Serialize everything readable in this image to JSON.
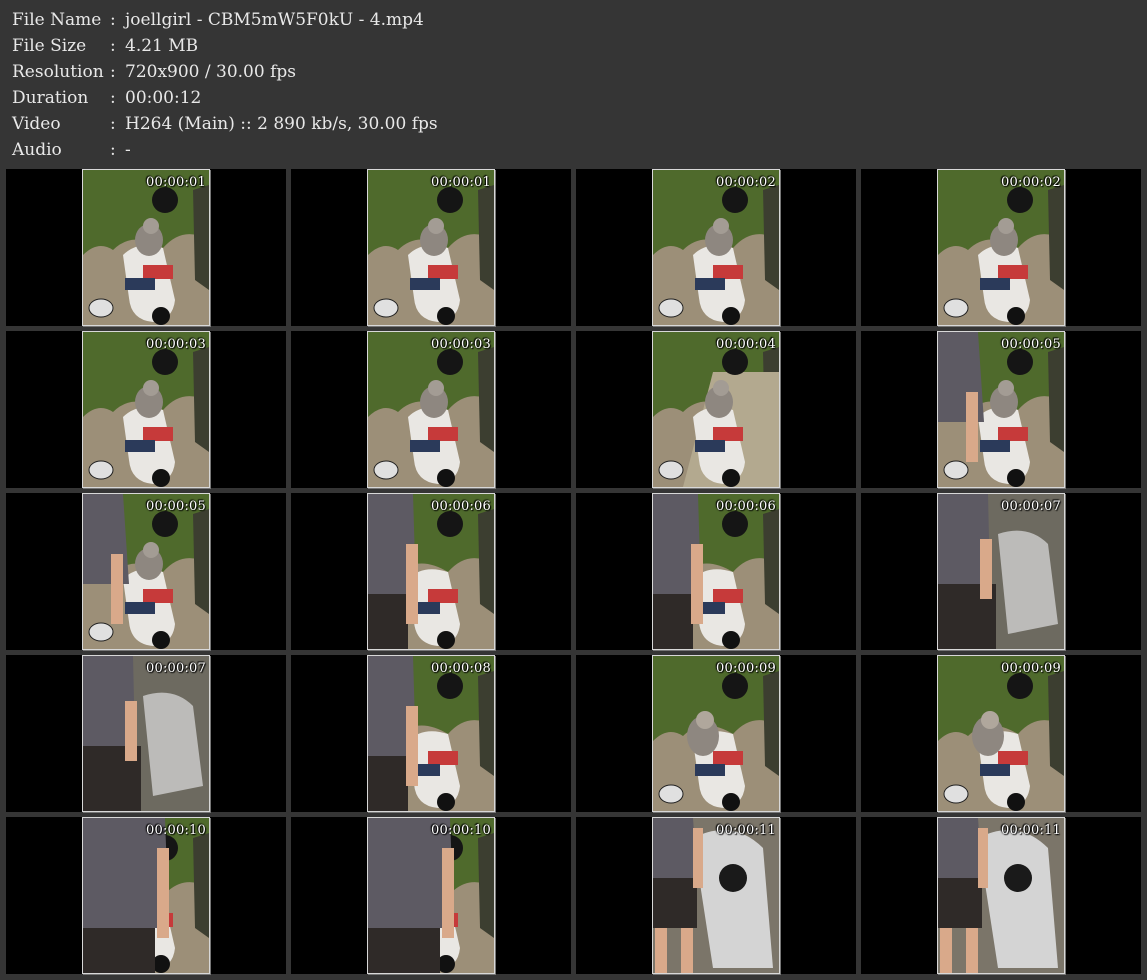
{
  "info": [
    {
      "label": "File Name",
      "value": "joellgirl - CBM5mW5F0kU - 4.mp4"
    },
    {
      "label": "File Size",
      "value": "4.21 MB"
    },
    {
      "label": "Resolution",
      "value": "720x900 / 30.00 fps"
    },
    {
      "label": "Duration",
      "value": "00:00:12"
    },
    {
      "label": "Video",
      "value": "H264 (Main) :: 2 890 kb/s, 30.00 fps"
    },
    {
      "label": "Audio",
      "value": "-"
    }
  ],
  "separator": ":",
  "colors": {
    "background": "#353535",
    "cell": "#000000",
    "text": "#e8e8e8",
    "foliage": "#4f6a2c",
    "road": "#9c8f78",
    "scooter": "#e9e7e3",
    "monkey": "#8e8780",
    "shirt": "#5d5a63",
    "skin": "#d9a98a",
    "shorts": "#2f2a28"
  },
  "thumbnails": [
    {
      "time": "00:00:01",
      "scene": "scooter"
    },
    {
      "time": "00:00:01",
      "scene": "scooter"
    },
    {
      "time": "00:00:02",
      "scene": "scooter"
    },
    {
      "time": "00:00:02",
      "scene": "scooter"
    },
    {
      "time": "00:00:03",
      "scene": "scooter"
    },
    {
      "time": "00:00:03",
      "scene": "scooter"
    },
    {
      "time": "00:00:04",
      "scene": "road"
    },
    {
      "time": "00:00:05",
      "scene": "person-edge"
    },
    {
      "time": "00:00:05",
      "scene": "person-edge"
    },
    {
      "time": "00:00:06",
      "scene": "person-side"
    },
    {
      "time": "00:00:06",
      "scene": "person-side"
    },
    {
      "time": "00:00:07",
      "scene": "blur"
    },
    {
      "time": "00:00:07",
      "scene": "blur"
    },
    {
      "time": "00:00:08",
      "scene": "person-side"
    },
    {
      "time": "00:00:09",
      "scene": "monkey-seat"
    },
    {
      "time": "00:00:09",
      "scene": "monkey-seat"
    },
    {
      "time": "00:00:10",
      "scene": "person-front"
    },
    {
      "time": "00:00:10",
      "scene": "person-front"
    },
    {
      "time": "00:00:11",
      "scene": "person-walk"
    },
    {
      "time": "00:00:11",
      "scene": "person-walk"
    }
  ]
}
